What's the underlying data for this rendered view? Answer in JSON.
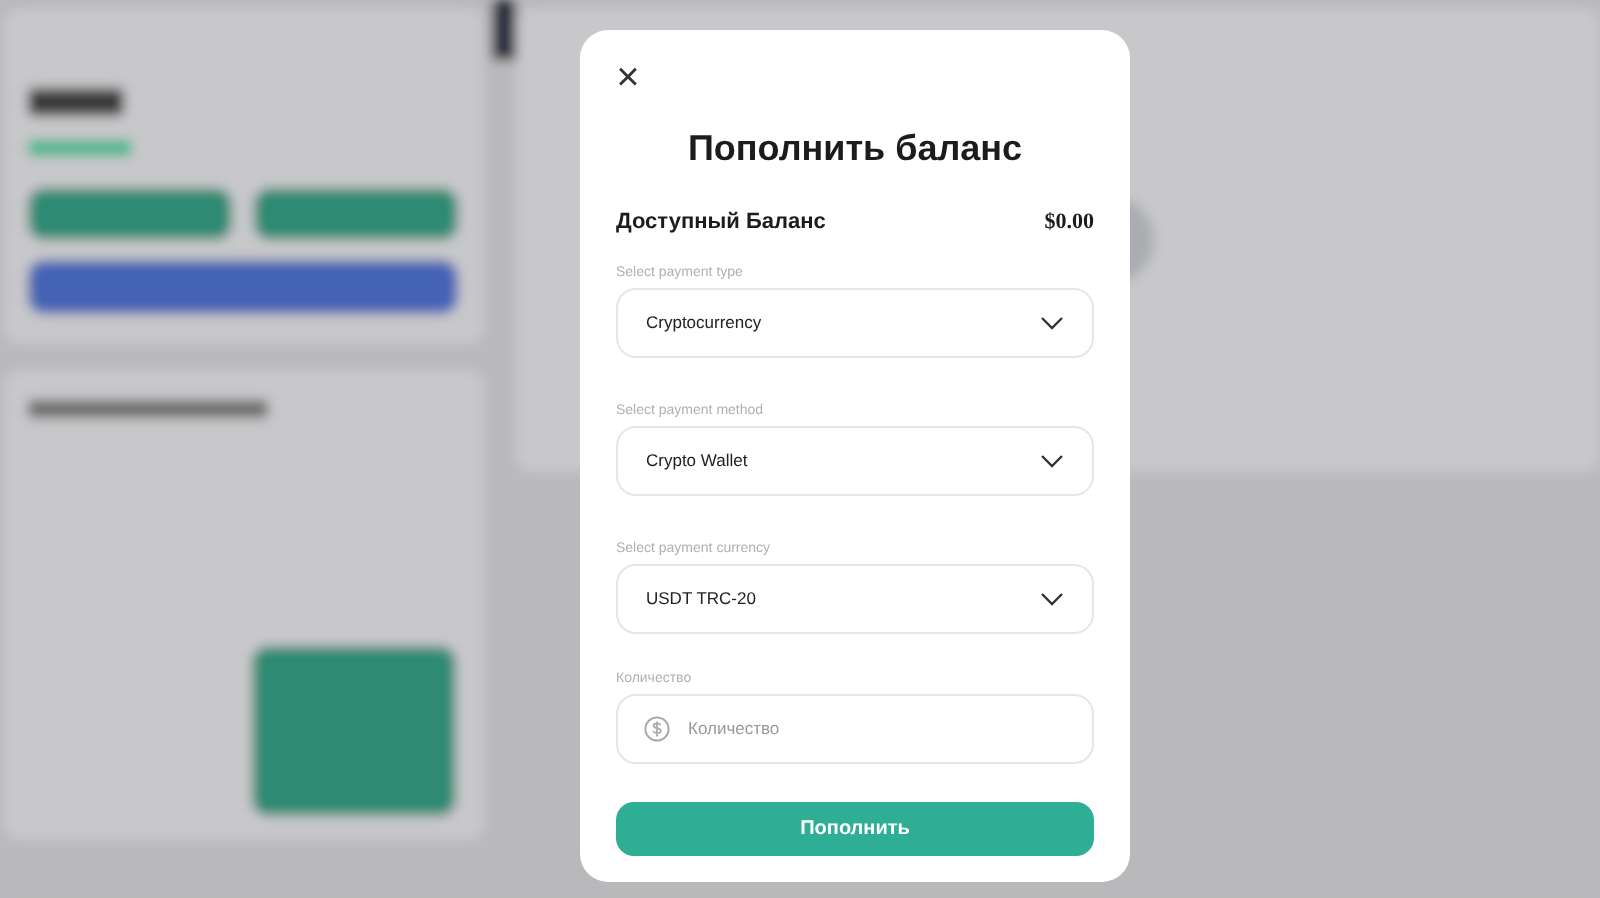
{
  "modal": {
    "close": "×",
    "title": "Пополнить баланс",
    "balance": {
      "label": "Доступный Баланс",
      "value": "$0.00"
    },
    "fields": [
      {
        "kind": "select",
        "label": "Select payment type",
        "value": "Cryptocurrency"
      },
      {
        "kind": "select",
        "label": "Select payment method",
        "value": "Crypto Wallet"
      },
      {
        "kind": "select",
        "label": "Select payment currency",
        "value": "USDT TRC-20"
      },
      {
        "kind": "amount",
        "label": "Количество",
        "placeholder": "Количество"
      }
    ],
    "submit": "Пополнить"
  }
}
